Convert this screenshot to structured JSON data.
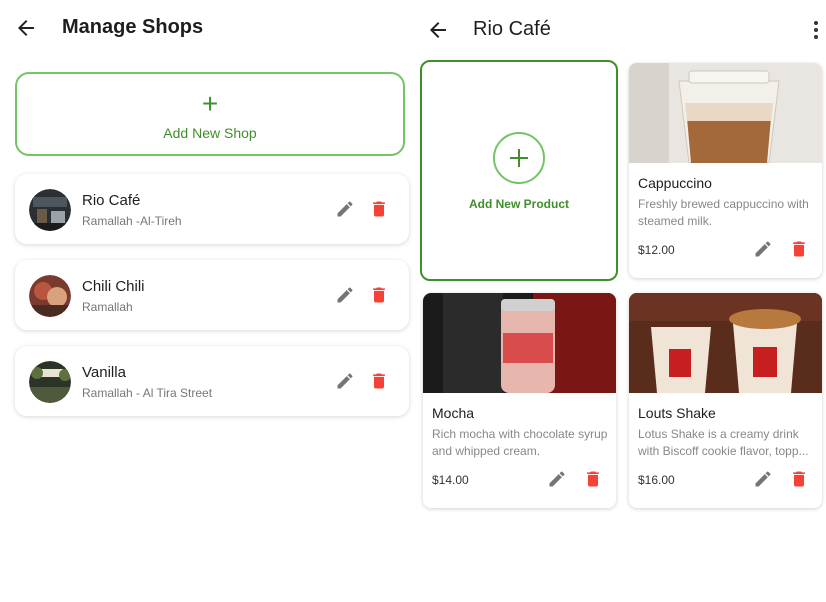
{
  "shops_screen": {
    "title": "Manage Shops",
    "add_button": {
      "icon": "+",
      "label": "Add New Shop"
    },
    "shops": [
      {
        "name": "Rio Café",
        "location": "Ramallah -Al-Tireh"
      },
      {
        "name": "Chili Chili",
        "location": "Ramallah"
      },
      {
        "name": "Vanilla",
        "location": "Ramallah - Al Tira Street"
      }
    ]
  },
  "shop_detail": {
    "title": "Rio Café",
    "add_product_label": "Add New Product",
    "products": [
      {
        "name": "Cappuccino",
        "description": "Freshly brewed cappuccino with steamed milk.",
        "price": "$12.00"
      },
      {
        "name": "Mocha",
        "description": "Rich mocha with chocolate syrup and whipped cream.",
        "price": "$14.00"
      },
      {
        "name": "Louts Shake",
        "description": "Lotus Shake is a creamy drink with Biscoff cookie flavor, topp...",
        "price": "$16.00"
      }
    ]
  },
  "colors": {
    "accent_green": "#3f8f2a",
    "border_green": "#74c466",
    "delete_red": "#f44336",
    "edit_gray": "#757575"
  }
}
